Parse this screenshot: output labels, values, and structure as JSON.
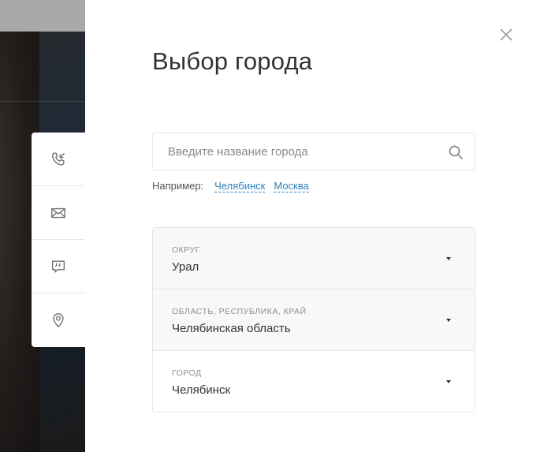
{
  "dialog": {
    "title": "Выбор города",
    "search": {
      "placeholder": "Введите название города",
      "value": ""
    },
    "examples": {
      "prefix": "Например:",
      "links": [
        "Челябинск",
        "Москва"
      ]
    },
    "selects": [
      {
        "label": "Округ",
        "value": "Урал"
      },
      {
        "label": "Область, республика, край",
        "value": "Челябинская область"
      },
      {
        "label": "Город",
        "value": "Челябинск"
      }
    ]
  },
  "side_panel": {
    "icons": [
      "callback-phone-icon",
      "mail-icon",
      "chat-icon",
      "location-pin-icon"
    ]
  },
  "colors": {
    "link": "#2e7fb8",
    "text": "#333333",
    "muted": "#8d8d8d"
  }
}
